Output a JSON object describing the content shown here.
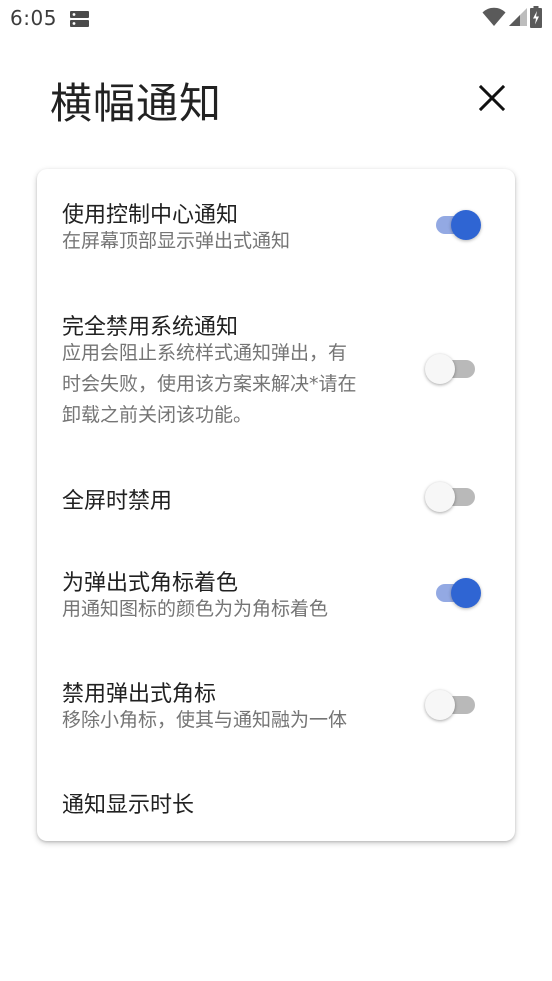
{
  "status_bar": {
    "time": "6:05",
    "icons": [
      "server-icon",
      "wifi-icon",
      "signal-icon",
      "battery-charging-icon"
    ]
  },
  "header": {
    "title": "横幅通知",
    "close_icon": "close-icon"
  },
  "settings": [
    {
      "title": "使用控制中心通知",
      "description_lines": [
        "在屏幕顶部显示弹出式通知"
      ],
      "toggle": true
    },
    {
      "title": "完全禁用系统通知",
      "description_lines": [
        "应用会阻止系统样式通知弹出，有",
        "时会失败，使用该方案来解决*请在",
        "卸载之前关闭该功能。"
      ],
      "toggle": false
    },
    {
      "title": "全屏时禁用",
      "description_lines": [],
      "toggle": false
    },
    {
      "title": "为弹出式角标着色",
      "description_lines": [
        "用通知图标的颜色为为角标着色"
      ],
      "toggle": true
    },
    {
      "title": "禁用弹出式角标",
      "description_lines": [
        "移除小角标，使其与通知融为一体"
      ],
      "toggle": false
    },
    {
      "title": "通知显示时长",
      "description_lines": []
    }
  ],
  "colors": {
    "accent": "#2f65d3",
    "accent_track": "#93a9e3",
    "off_track": "#b9b9b9",
    "off_thumb": "#f7f7f7",
    "title_text": "#212121",
    "secondary_text": "#757575"
  }
}
